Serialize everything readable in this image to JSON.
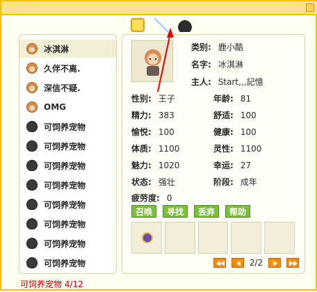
{
  "top_tabs": [
    "crown-icon",
    "sword-icon",
    "hat-icon"
  ],
  "pet_list": [
    {
      "name": "冰淇淋",
      "type": "face"
    },
    {
      "name": "久伴不离.",
      "type": "face"
    },
    {
      "name": "深信不疑.",
      "type": "face"
    },
    {
      "name": "OMG",
      "type": "face"
    },
    {
      "name": "可饲养宠物",
      "type": "shadow"
    },
    {
      "name": "可饲养宠物",
      "type": "shadow"
    },
    {
      "name": "可饲养宠物",
      "type": "shadow"
    },
    {
      "name": "可饲养宠物",
      "type": "shadow"
    },
    {
      "name": "可饲养宠物",
      "type": "shadow"
    },
    {
      "name": "可饲养宠物",
      "type": "shadow"
    },
    {
      "name": "可饲养宠物",
      "type": "shadow"
    },
    {
      "name": "可饲养宠物",
      "type": "shadow"
    }
  ],
  "info": {
    "category_label": "类别:",
    "category_value": "鹿小酷",
    "name_label": "名字:",
    "name_value": "冰淇淋",
    "owner_label": "主人:",
    "owner_value": "Start‚,,記憶"
  },
  "stats": {
    "gender_label": "性别:",
    "gender_value": "王子",
    "age_label": "年龄:",
    "age_value": "81",
    "energy_label": "精力:",
    "energy_value": "383",
    "comfort_label": "舒适:",
    "comfort_value": "100",
    "joy_label": "愉悦:",
    "joy_value": "100",
    "health_label": "健康:",
    "health_value": "100",
    "physique_label": "体质:",
    "physique_value": "1100",
    "spirit_label": "灵性:",
    "spirit_value": "1100",
    "charm_label": "魅力:",
    "charm_value": "1020",
    "luck_label": "幸运:",
    "luck_value": "27",
    "state_label": "状态:",
    "state_value": "强壮",
    "stage_label": "阶段:",
    "stage_value": "成年",
    "fatigue_label": "疲劳度:",
    "fatigue_value": "0"
  },
  "actions": {
    "summon": "召唤",
    "find": "寻找",
    "discard": "丢弃",
    "help": "帮助"
  },
  "pager": {
    "text": "2/2"
  },
  "footer": {
    "text": "可饲养宠物 4/12"
  },
  "colors": {
    "border": "#f2c200",
    "header": "#ffe28a",
    "accent_green": "#7bbf3d",
    "footer_red": "#c20000",
    "pager_orange": "#ff8a00"
  }
}
